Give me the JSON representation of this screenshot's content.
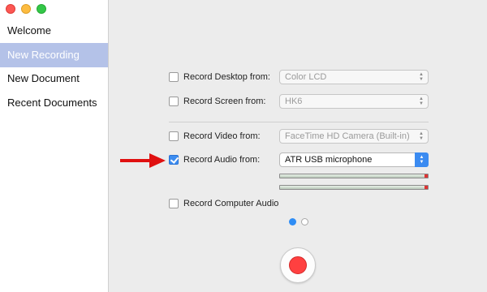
{
  "sidebar": {
    "items": [
      {
        "label": "Welcome",
        "selected": false
      },
      {
        "label": "New Recording",
        "selected": true
      },
      {
        "label": "New Document",
        "selected": false
      },
      {
        "label": "Recent Documents",
        "selected": false
      }
    ]
  },
  "options": {
    "desktop": {
      "label": "Record Desktop from:",
      "checked": false,
      "value": "Color LCD"
    },
    "screen": {
      "label": "Record Screen from:",
      "checked": false,
      "value": "HK6"
    },
    "video": {
      "label": "Record Video from:",
      "checked": false,
      "value": "FaceTime HD Camera (Built-in)"
    },
    "audio": {
      "label": "Record Audio from:",
      "checked": true,
      "value": "ATR USB microphone"
    },
    "computer_audio": {
      "label": "Record Computer Audio",
      "checked": false
    }
  },
  "audio_meters": {
    "left_level": 0.98,
    "right_level": 0.98
  },
  "pagination": {
    "current": 1,
    "total": 2
  },
  "colors": {
    "accent": "#3b8bf1",
    "sidebar_selected": "#b4c2e8",
    "record": "#ff4040",
    "annotation_arrow": "#e01010"
  },
  "icons": {
    "annotation": "red-arrow-icon",
    "record": "record-icon"
  }
}
